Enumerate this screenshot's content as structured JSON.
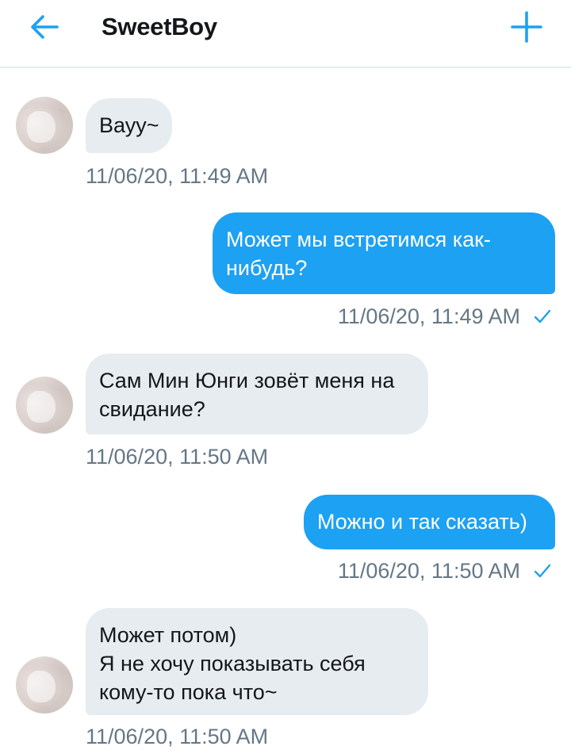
{
  "header": {
    "title": "SweetBoy"
  },
  "colors": {
    "accent": "#1da1f2",
    "incoming_bubble": "#e6ecf0",
    "timestamp": "#657786"
  },
  "icons": {
    "back": "arrow-left-icon",
    "add": "plus-icon",
    "read": "checkmark-icon"
  },
  "messages": [
    {
      "direction": "incoming",
      "text": "Вауу~",
      "timestamp": "11/06/20, 11:49 AM"
    },
    {
      "direction": "outgoing",
      "text": "Может мы встретимся как-\nнибудь?",
      "timestamp": "11/06/20, 11:49 AM",
      "read": true
    },
    {
      "direction": "incoming",
      "text": "Сам Мин Юнги зовёт меня на\nсвидание?",
      "timestamp": "11/06/20, 11:50 AM"
    },
    {
      "direction": "outgoing",
      "text": "Можно и так сказать)",
      "timestamp": "11/06/20, 11:50 AM",
      "read": true
    },
    {
      "direction": "incoming",
      "text": "Может потом)\nЯ не хочу показывать себя\nкому-то пока что~",
      "timestamp": "11/06/20, 11:50 AM"
    }
  ]
}
